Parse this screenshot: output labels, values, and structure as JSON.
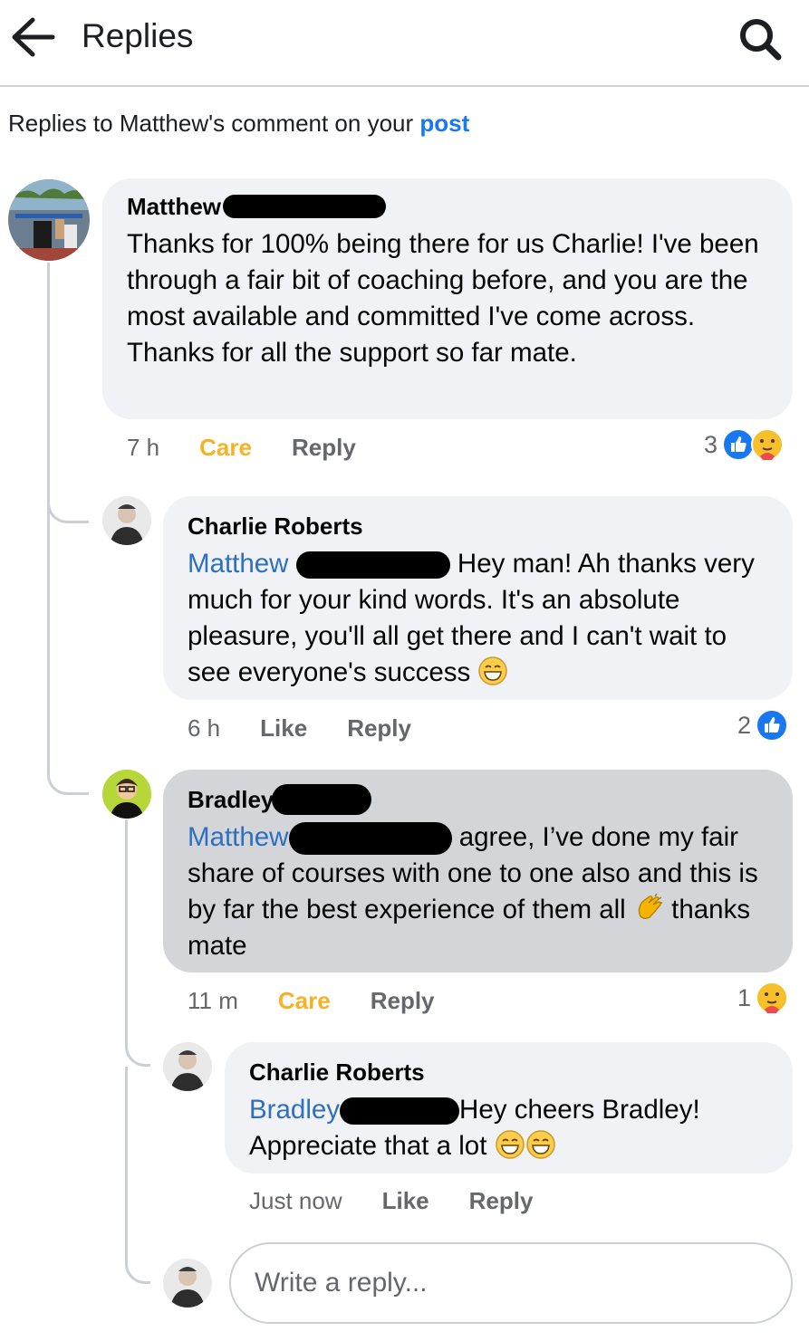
{
  "header": {
    "title": "Replies",
    "back_icon": "arrow-left-icon",
    "search_icon": "search-icon"
  },
  "context": {
    "prefix": "Replies to Matthew's comment on your ",
    "link": "post"
  },
  "comments": [
    {
      "author": "Matthew",
      "text": "Thanks for 100% being there for us Charlie! I've been through a fair bit of coaching before, and you are the most available and committed I've come across. Thanks for all the support so far mate.",
      "time": "7 h",
      "action1": "Care",
      "action2": "Reply",
      "reaction_count": "3",
      "reactions": [
        "like",
        "care"
      ]
    },
    {
      "author": "Charlie Roberts",
      "mention": "Matthew",
      "text": "Hey man! Ah thanks very much for your kind words. It's an absolute pleasure, you'll all get there and I can't wait to see everyone's success",
      "time": "6 h",
      "action1": "Like",
      "action2": "Reply",
      "reaction_count": "2",
      "reactions": [
        "like"
      ]
    },
    {
      "author": "Bradley",
      "mention": "Matthew",
      "text_a": "agree, I’ve done my fair share of courses with one to one also and this is by far the best experience of them all",
      "text_b": "thanks mate",
      "time": "11 m",
      "action1": "Care",
      "action2": "Reply",
      "reaction_count": "1",
      "reactions": [
        "care"
      ]
    },
    {
      "author": "Charlie Roberts",
      "mention": "Bradley",
      "text": "Hey cheers Bradley! Appreciate that a lot",
      "time": "Just now",
      "action1": "Like",
      "action2": "Reply"
    }
  ],
  "composer": {
    "placeholder": "Write a reply..."
  },
  "colors": {
    "link_blue": "#1877f2",
    "mention_blue": "#2e6fc0",
    "care_yellow": "#f7b125",
    "bubble_bg": "#f0f2f5",
    "highlight_bg": "#d3d5d9"
  }
}
